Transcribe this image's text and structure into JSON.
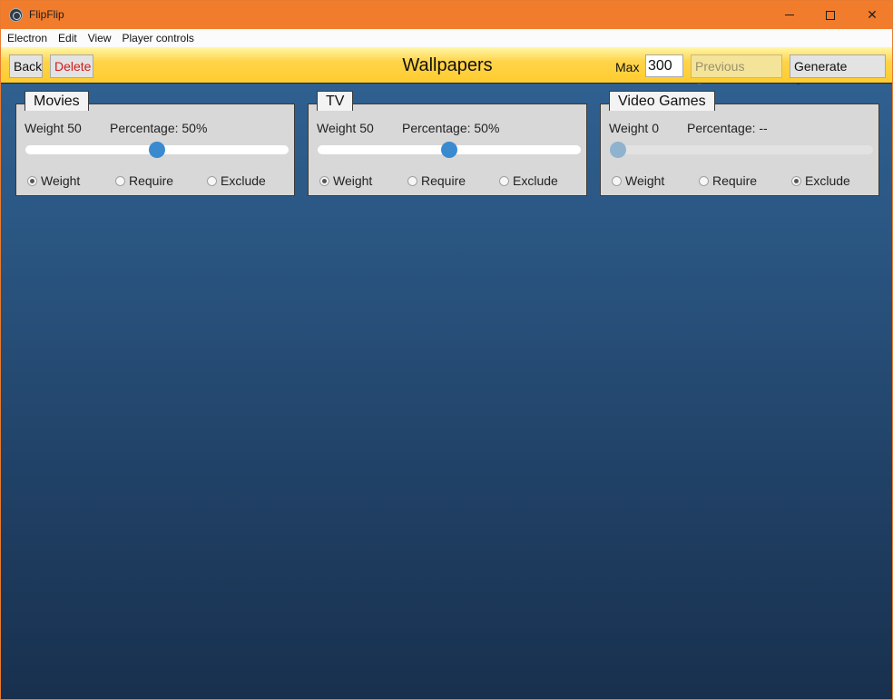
{
  "window": {
    "app_title": "FlipFlip",
    "minimize_glyph": "",
    "close_glyph": "✕"
  },
  "menu": [
    "Electron",
    "Edit",
    "View",
    "Player controls"
  ],
  "header": {
    "back_label": "Back",
    "delete_label": "Delete",
    "title": "Wallpapers",
    "max_label": "Max",
    "max_value": "300",
    "previous_scene_label": "Previous Scene",
    "generate_scene_label": "Generate Scene"
  },
  "colors": {
    "titlebar": "#f07c2c",
    "header": "#ffcc2e",
    "accent": "#3a8ad0",
    "delete": "#d21a1a"
  },
  "cards": [
    {
      "tab": "Movies",
      "weight_text": "Weight 50",
      "percentage_text": "Percentage: 50%",
      "slider_value": 50,
      "slider_disabled": false,
      "radios": [
        "Weight",
        "Require",
        "Exclude"
      ],
      "selected": "Weight"
    },
    {
      "tab": "TV",
      "weight_text": "Weight 50",
      "percentage_text": "Percentage: 50%",
      "slider_value": 50,
      "slider_disabled": false,
      "radios": [
        "Weight",
        "Require",
        "Exclude"
      ],
      "selected": "Weight"
    },
    {
      "tab": "Video Games",
      "weight_text": "Weight 0",
      "percentage_text": "Percentage: --",
      "slider_value": 0,
      "slider_disabled": true,
      "radios": [
        "Weight",
        "Require",
        "Exclude"
      ],
      "selected": "Exclude"
    }
  ]
}
